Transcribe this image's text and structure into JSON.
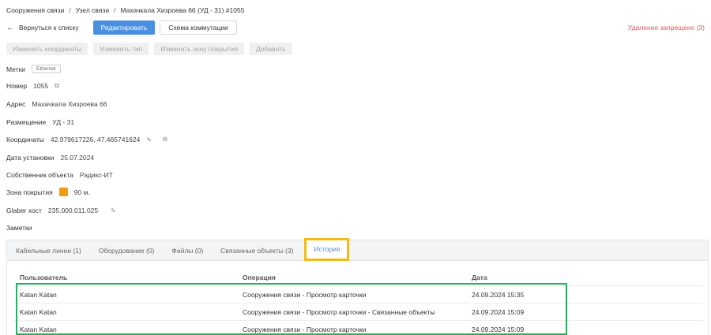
{
  "breadcrumb": {
    "items": [
      "Сооружения связи",
      "Узел связи",
      "Махачкала Хизроева 66 (УД - 31) #1055"
    ],
    "separator": "/"
  },
  "toolbar": {
    "back_label": "Вернуться к списку",
    "edit_label": "Редактировать",
    "scheme_label": "Схема коммутации",
    "delete_label": "Удаление запрещено (3)"
  },
  "actions": {
    "change_coords": "Изменить координаты",
    "change_type": "Изменить тип",
    "change_zone": "Изменить зону покрытия",
    "add": "Добавить"
  },
  "fields": {
    "tags_label": "Метки",
    "tag_value": "Ethernet",
    "number_label": "Номер",
    "number_value": "1055",
    "address_label": "Адрес",
    "address_value": "Махачкала Хизроева 66",
    "placement_label": "Размещение",
    "placement_value": "УД - 31",
    "coords_label": "Координаты",
    "coords_value": "42.979617226, 47.465741624",
    "install_label": "Дата установки",
    "install_value": "25.07.2024",
    "owner_label": "Собственник объекта",
    "owner_value": "Радикс-ИТ",
    "zone_label": "Зона покрытия",
    "zone_value": "90 м.",
    "zone_color": "#f39c12",
    "glaber_label": "Glaber хост",
    "glaber_value": "235.000.011.025",
    "notes_label": "Заметки"
  },
  "tabs": [
    {
      "label": "Кабельные линии (1)"
    },
    {
      "label": "Оборудование (0)"
    },
    {
      "label": "Файлы (0)"
    },
    {
      "label": "Связанные объекты (3)"
    },
    {
      "label": "История"
    }
  ],
  "history": {
    "headers": {
      "user": "Пользователь",
      "operation": "Операция",
      "date": "Дата"
    },
    "rows": [
      {
        "user": "Katan Katan",
        "operation": "Сооружения связи - Просмотр карточки",
        "date": "24.09.2024 15:35"
      },
      {
        "user": "Katan Katan",
        "operation": "Сооружения связи - Просмотр карточки - Связанные объекты",
        "date": "24.09.2024 15:09"
      },
      {
        "user": "Katan Katan",
        "operation": "Сооружения связи - Просмотр карточки",
        "date": "24.09.2024 15:09"
      }
    ]
  },
  "colors": {
    "primary": "#4a8fe0",
    "danger": "#e05555",
    "highlight_tab": "#f3b91d",
    "highlight_rows": "#27ae60"
  }
}
